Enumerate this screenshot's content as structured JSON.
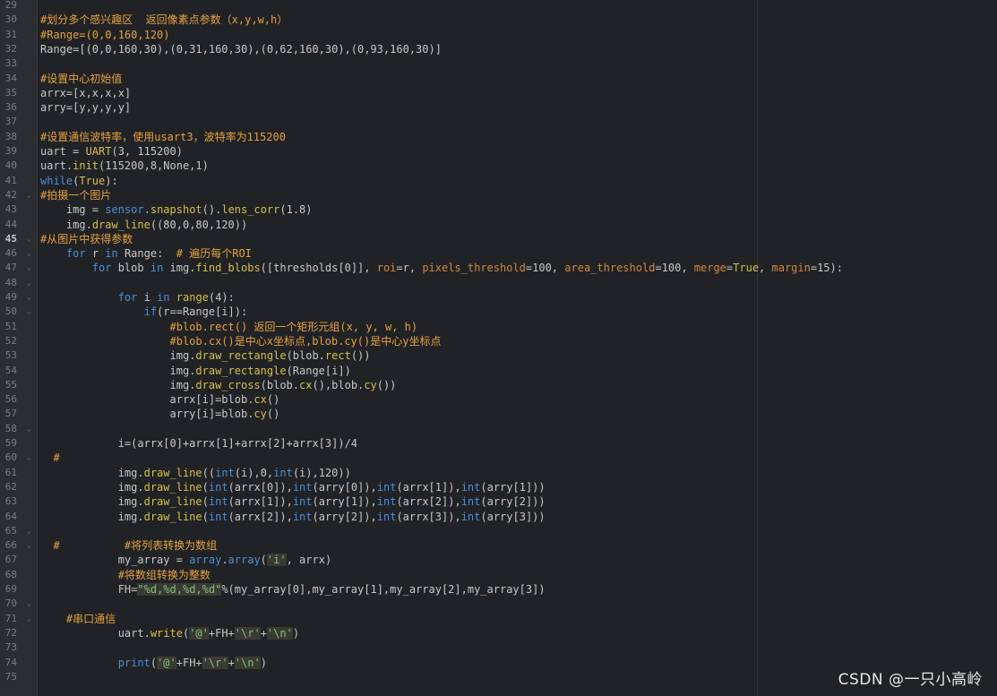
{
  "colors": {
    "background": "#202226",
    "gutter": "#2b2d31",
    "comment": "#e6a23c",
    "keyword": "#4a8fd8",
    "function": "#d4c04a",
    "string": "#7ec27e",
    "number": "#d8cfa8",
    "text": "#c8c8c8"
  },
  "current_line": 45,
  "watermark": "CSDN @一只小高岭",
  "lines": [
    {
      "n": "29",
      "fold": false,
      "indent": "",
      "tokens": []
    },
    {
      "n": "30",
      "fold": false,
      "indent": "",
      "tokens": [
        {
          "t": "c",
          "v": "#划分多个感兴趣区  返回像素点参数（x,y,w,h）"
        }
      ]
    },
    {
      "n": "31",
      "fold": false,
      "indent": "",
      "tokens": [
        {
          "t": "c",
          "v": "#Range=(0,0,160,120)"
        }
      ]
    },
    {
      "n": "32",
      "fold": false,
      "indent": "",
      "tokens": [
        {
          "t": "p",
          "v": "Range=[(0,0,160,30),(0,31,160,30),(0,62,160,30),(0,93,160,30)]"
        }
      ]
    },
    {
      "n": "33",
      "fold": false,
      "indent": "",
      "tokens": []
    },
    {
      "n": "34",
      "fold": false,
      "indent": "",
      "tokens": [
        {
          "t": "c",
          "v": "#设置中心初始值"
        }
      ]
    },
    {
      "n": "35",
      "fold": false,
      "indent": "",
      "tokens": [
        {
          "t": "p",
          "v": "arrx=[x,x,x,x]"
        }
      ]
    },
    {
      "n": "36",
      "fold": false,
      "indent": "",
      "tokens": [
        {
          "t": "p",
          "v": "arry=[y,y,y,y]"
        }
      ]
    },
    {
      "n": "37",
      "fold": false,
      "indent": "",
      "tokens": []
    },
    {
      "n": "38",
      "fold": false,
      "indent": "",
      "tokens": [
        {
          "t": "c",
          "v": "#设置通信波特率，使用usart3，波特率为115200"
        }
      ]
    },
    {
      "n": "39",
      "fold": false,
      "indent": "",
      "tokens": [
        {
          "t": "p",
          "v": "uart = "
        },
        {
          "t": "f",
          "v": "UART"
        },
        {
          "t": "p",
          "v": "(3, 115200)"
        }
      ]
    },
    {
      "n": "40",
      "fold": false,
      "indent": "",
      "tokens": [
        {
          "t": "p",
          "v": "uart."
        },
        {
          "t": "f",
          "v": "init"
        },
        {
          "t": "p",
          "v": "(115200,8,None,1)"
        }
      ]
    },
    {
      "n": "41",
      "fold": false,
      "indent": "",
      "tokens": [
        {
          "t": "k",
          "v": "while"
        },
        {
          "t": "p",
          "v": "("
        },
        {
          "t": "f",
          "v": "True"
        },
        {
          "t": "p",
          "v": "):"
        }
      ]
    },
    {
      "n": "42",
      "fold": true,
      "indent": "",
      "tokens": [
        {
          "t": "c",
          "v": "#拍摄一个图片"
        }
      ]
    },
    {
      "n": "43",
      "fold": false,
      "indent": "    ",
      "tokens": [
        {
          "t": "p",
          "v": "img = "
        },
        {
          "t": "k",
          "v": "sensor"
        },
        {
          "t": "p",
          "v": "."
        },
        {
          "t": "f",
          "v": "snapshot"
        },
        {
          "t": "p",
          "v": "()."
        },
        {
          "t": "f",
          "v": "lens_corr"
        },
        {
          "t": "p",
          "v": "(1.8)"
        }
      ]
    },
    {
      "n": "44",
      "fold": false,
      "indent": "    ",
      "tokens": [
        {
          "t": "p",
          "v": "img."
        },
        {
          "t": "f",
          "v": "draw_line"
        },
        {
          "t": "p",
          "v": "((80,0,80,120))"
        }
      ]
    },
    {
      "n": "45",
      "fold": true,
      "indent": "",
      "tokens": [
        {
          "t": "c",
          "v": "#从图片中获得参数"
        }
      ]
    },
    {
      "n": "46",
      "fold": true,
      "indent": "    ",
      "tokens": [
        {
          "t": "k",
          "v": "for"
        },
        {
          "t": "p",
          "v": " r "
        },
        {
          "t": "k",
          "v": "in"
        },
        {
          "t": "p",
          "v": " Range:  "
        },
        {
          "t": "c",
          "v": "# 遍历每个ROI"
        }
      ]
    },
    {
      "n": "47",
      "fold": true,
      "indent": "        ",
      "tokens": [
        {
          "t": "k",
          "v": "for"
        },
        {
          "t": "p",
          "v": " blob "
        },
        {
          "t": "k",
          "v": "in"
        },
        {
          "t": "p",
          "v": " img."
        },
        {
          "t": "f",
          "v": "find_blobs"
        },
        {
          "t": "p",
          "v": "([thresholds[0]], "
        },
        {
          "t": "a",
          "v": "roi"
        },
        {
          "t": "p",
          "v": "=r, "
        },
        {
          "t": "a",
          "v": "pixels_threshold"
        },
        {
          "t": "p",
          "v": "=100, "
        },
        {
          "t": "a",
          "v": "area_threshold"
        },
        {
          "t": "p",
          "v": "=100, "
        },
        {
          "t": "a",
          "v": "merge"
        },
        {
          "t": "p",
          "v": "="
        },
        {
          "t": "f",
          "v": "True"
        },
        {
          "t": "p",
          "v": ", "
        },
        {
          "t": "a",
          "v": "margin"
        },
        {
          "t": "p",
          "v": "=15):"
        }
      ]
    },
    {
      "n": "48",
      "fold": true,
      "indent": "",
      "tokens": []
    },
    {
      "n": "49",
      "fold": true,
      "indent": "            ",
      "tokens": [
        {
          "t": "k",
          "v": "for"
        },
        {
          "t": "p",
          "v": " i "
        },
        {
          "t": "k",
          "v": "in"
        },
        {
          "t": "p",
          "v": " "
        },
        {
          "t": "f",
          "v": "range"
        },
        {
          "t": "p",
          "v": "(4):"
        }
      ]
    },
    {
      "n": "50",
      "fold": true,
      "indent": "                ",
      "tokens": [
        {
          "t": "k",
          "v": "if"
        },
        {
          "t": "p",
          "v": "(r==Range[i]):"
        }
      ]
    },
    {
      "n": "51",
      "fold": false,
      "indent": "                    ",
      "tokens": [
        {
          "t": "c",
          "v": "#blob.rect() 返回一个矩形元组(x, y, w, h)"
        }
      ]
    },
    {
      "n": "52",
      "fold": false,
      "indent": "                    ",
      "tokens": [
        {
          "t": "c",
          "v": "#blob.cx()是中心x坐标点,blob.cy()是中心y坐标点"
        }
      ]
    },
    {
      "n": "53",
      "fold": false,
      "indent": "                    ",
      "tokens": [
        {
          "t": "p",
          "v": "img."
        },
        {
          "t": "f",
          "v": "draw_rectangle"
        },
        {
          "t": "p",
          "v": "(blob."
        },
        {
          "t": "f",
          "v": "rect"
        },
        {
          "t": "p",
          "v": "())"
        }
      ]
    },
    {
      "n": "54",
      "fold": false,
      "indent": "                    ",
      "tokens": [
        {
          "t": "p",
          "v": "img."
        },
        {
          "t": "f",
          "v": "draw_rectangle"
        },
        {
          "t": "p",
          "v": "(Range[i])"
        }
      ]
    },
    {
      "n": "55",
      "fold": false,
      "indent": "                    ",
      "tokens": [
        {
          "t": "p",
          "v": "img."
        },
        {
          "t": "f",
          "v": "draw_cross"
        },
        {
          "t": "p",
          "v": "(blob."
        },
        {
          "t": "f",
          "v": "cx"
        },
        {
          "t": "p",
          "v": "(),blob."
        },
        {
          "t": "f",
          "v": "cy"
        },
        {
          "t": "p",
          "v": "())"
        }
      ]
    },
    {
      "n": "56",
      "fold": false,
      "indent": "                    ",
      "tokens": [
        {
          "t": "p",
          "v": "arrx[i]=blob."
        },
        {
          "t": "f",
          "v": "cx"
        },
        {
          "t": "p",
          "v": "()"
        }
      ]
    },
    {
      "n": "57",
      "fold": false,
      "indent": "                    ",
      "tokens": [
        {
          "t": "p",
          "v": "arry[i]=blob."
        },
        {
          "t": "f",
          "v": "cy"
        },
        {
          "t": "p",
          "v": "()"
        }
      ]
    },
    {
      "n": "58",
      "fold": true,
      "indent": "",
      "tokens": []
    },
    {
      "n": "59",
      "fold": false,
      "indent": "            ",
      "tokens": [
        {
          "t": "p",
          "v": "i=(arrx[0]+arrx[1]+arrx[2]+arrx[3])/4"
        }
      ]
    },
    {
      "n": "60",
      "fold": true,
      "indent": "  ",
      "tokens": [
        {
          "t": "c",
          "v": "#"
        }
      ]
    },
    {
      "n": "61",
      "fold": false,
      "indent": "            ",
      "tokens": [
        {
          "t": "p",
          "v": "img."
        },
        {
          "t": "f",
          "v": "draw_line"
        },
        {
          "t": "p",
          "v": "(("
        },
        {
          "t": "k",
          "v": "int"
        },
        {
          "t": "p",
          "v": "(i),0,"
        },
        {
          "t": "k",
          "v": "int"
        },
        {
          "t": "p",
          "v": "(i),120))"
        }
      ]
    },
    {
      "n": "62",
      "fold": false,
      "indent": "            ",
      "tokens": [
        {
          "t": "p",
          "v": "img."
        },
        {
          "t": "f",
          "v": "draw_line"
        },
        {
          "t": "p",
          "v": "("
        },
        {
          "t": "k",
          "v": "int"
        },
        {
          "t": "p",
          "v": "(arrx[0]),"
        },
        {
          "t": "k",
          "v": "int"
        },
        {
          "t": "p",
          "v": "(arry[0]),"
        },
        {
          "t": "k",
          "v": "int"
        },
        {
          "t": "p",
          "v": "(arrx[1]),"
        },
        {
          "t": "k",
          "v": "int"
        },
        {
          "t": "p",
          "v": "(arry[1]))"
        }
      ]
    },
    {
      "n": "63",
      "fold": false,
      "indent": "            ",
      "tokens": [
        {
          "t": "p",
          "v": "img."
        },
        {
          "t": "f",
          "v": "draw_line"
        },
        {
          "t": "p",
          "v": "("
        },
        {
          "t": "k",
          "v": "int"
        },
        {
          "t": "p",
          "v": "(arrx[1]),"
        },
        {
          "t": "k",
          "v": "int"
        },
        {
          "t": "p",
          "v": "(arry[1]),"
        },
        {
          "t": "k",
          "v": "int"
        },
        {
          "t": "p",
          "v": "(arrx[2]),"
        },
        {
          "t": "k",
          "v": "int"
        },
        {
          "t": "p",
          "v": "(arry[2]))"
        }
      ]
    },
    {
      "n": "64",
      "fold": false,
      "indent": "            ",
      "tokens": [
        {
          "t": "p",
          "v": "img."
        },
        {
          "t": "f",
          "v": "draw_line"
        },
        {
          "t": "p",
          "v": "("
        },
        {
          "t": "k",
          "v": "int"
        },
        {
          "t": "p",
          "v": "(arrx[2]),"
        },
        {
          "t": "k",
          "v": "int"
        },
        {
          "t": "p",
          "v": "(arry[2]),"
        },
        {
          "t": "k",
          "v": "int"
        },
        {
          "t": "p",
          "v": "(arrx[3]),"
        },
        {
          "t": "k",
          "v": "int"
        },
        {
          "t": "p",
          "v": "(arry[3]))"
        }
      ]
    },
    {
      "n": "65",
      "fold": true,
      "indent": "",
      "tokens": []
    },
    {
      "n": "66",
      "fold": true,
      "indent": "  ",
      "tokens": [
        {
          "t": "c",
          "v": "#          #将列表转换为数组"
        }
      ]
    },
    {
      "n": "67",
      "fold": false,
      "indent": "            ",
      "tokens": [
        {
          "t": "p",
          "v": "my_array = "
        },
        {
          "t": "k",
          "v": "array"
        },
        {
          "t": "p",
          "v": "."
        },
        {
          "t": "k",
          "v": "array"
        },
        {
          "t": "p",
          "v": "("
        },
        {
          "t": "s",
          "v": "'i'"
        },
        {
          "t": "p",
          "v": ", arrx)"
        }
      ]
    },
    {
      "n": "68",
      "fold": false,
      "indent": "            ",
      "tokens": [
        {
          "t": "c",
          "v": "#将数组转换为整数"
        }
      ]
    },
    {
      "n": "69",
      "fold": false,
      "indent": "            ",
      "tokens": [
        {
          "t": "p",
          "v": "FH="
        },
        {
          "t": "s",
          "v": "\"%d,%d,%d,%d\""
        },
        {
          "t": "p",
          "v": "%(my_array[0],my_array[1],my_array[2],my_array[3])"
        }
      ]
    },
    {
      "n": "70",
      "fold": true,
      "indent": "",
      "tokens": []
    },
    {
      "n": "71",
      "fold": true,
      "indent": "    ",
      "tokens": [
        {
          "t": "c",
          "v": "#串口通信"
        }
      ]
    },
    {
      "n": "72",
      "fold": false,
      "indent": "            ",
      "tokens": [
        {
          "t": "p",
          "v": "uart."
        },
        {
          "t": "f",
          "v": "write"
        },
        {
          "t": "p",
          "v": "("
        },
        {
          "t": "s",
          "v": "'@'"
        },
        {
          "t": "p",
          "v": "+FH+"
        },
        {
          "t": "s",
          "v": "'\\r'"
        },
        {
          "t": "p",
          "v": "+"
        },
        {
          "t": "s",
          "v": "'\\n'"
        },
        {
          "t": "p",
          "v": ")"
        }
      ]
    },
    {
      "n": "73",
      "fold": false,
      "indent": "",
      "tokens": []
    },
    {
      "n": "74",
      "fold": false,
      "indent": "            ",
      "tokens": [
        {
          "t": "k",
          "v": "print"
        },
        {
          "t": "p",
          "v": "("
        },
        {
          "t": "s",
          "v": "'@'"
        },
        {
          "t": "p",
          "v": "+FH+"
        },
        {
          "t": "s",
          "v": "'\\r'"
        },
        {
          "t": "p",
          "v": "+"
        },
        {
          "t": "s",
          "v": "'\\n'"
        },
        {
          "t": "p",
          "v": ")"
        }
      ]
    },
    {
      "n": "75",
      "fold": false,
      "indent": "",
      "tokens": []
    }
  ]
}
